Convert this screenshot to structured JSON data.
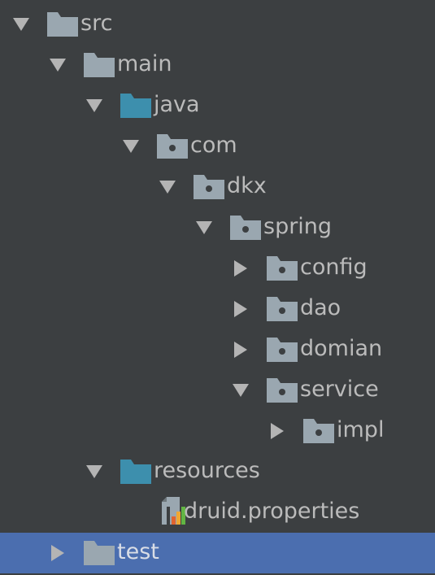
{
  "tree": {
    "items": [
      {
        "label": "src",
        "depth": 0,
        "expanded": true,
        "icon": "folder-icon",
        "has_arrow": true,
        "selected": false
      },
      {
        "label": "main",
        "depth": 1,
        "expanded": true,
        "icon": "folder-icon",
        "has_arrow": true,
        "selected": false
      },
      {
        "label": "java",
        "depth": 2,
        "expanded": true,
        "icon": "source-root-folder-icon",
        "has_arrow": true,
        "selected": false
      },
      {
        "label": "com",
        "depth": 3,
        "expanded": true,
        "icon": "package-icon",
        "has_arrow": true,
        "selected": false
      },
      {
        "label": "dkx",
        "depth": 4,
        "expanded": true,
        "icon": "package-icon",
        "has_arrow": true,
        "selected": false
      },
      {
        "label": "spring",
        "depth": 5,
        "expanded": true,
        "icon": "package-icon",
        "has_arrow": true,
        "selected": false
      },
      {
        "label": "config",
        "depth": 6,
        "expanded": false,
        "icon": "package-icon",
        "has_arrow": true,
        "selected": false
      },
      {
        "label": "dao",
        "depth": 6,
        "expanded": false,
        "icon": "package-icon",
        "has_arrow": true,
        "selected": false
      },
      {
        "label": "domian",
        "depth": 6,
        "expanded": false,
        "icon": "package-icon",
        "has_arrow": true,
        "selected": false
      },
      {
        "label": "service",
        "depth": 6,
        "expanded": true,
        "icon": "package-icon",
        "has_arrow": true,
        "selected": false
      },
      {
        "label": "impl",
        "depth": 7,
        "expanded": false,
        "icon": "package-icon",
        "has_arrow": true,
        "selected": false
      },
      {
        "label": "resources",
        "depth": 2,
        "expanded": true,
        "icon": "resources-root-folder-icon",
        "has_arrow": true,
        "selected": false
      },
      {
        "label": "druid.properties",
        "depth": 3,
        "expanded": false,
        "icon": "properties-file-icon",
        "has_arrow": false,
        "selected": false
      },
      {
        "label": "test",
        "depth": 1,
        "expanded": false,
        "icon": "folder-icon",
        "has_arrow": true,
        "selected": true
      }
    ]
  },
  "colors": {
    "background": "#3c3f41",
    "selection": "#4b6eaf",
    "text": "#bbbbbb",
    "arrow": "#b4b4b4",
    "folder": "#9aa7b0",
    "source_root": "#3d8fad",
    "package_dot": "#3c3f41"
  }
}
